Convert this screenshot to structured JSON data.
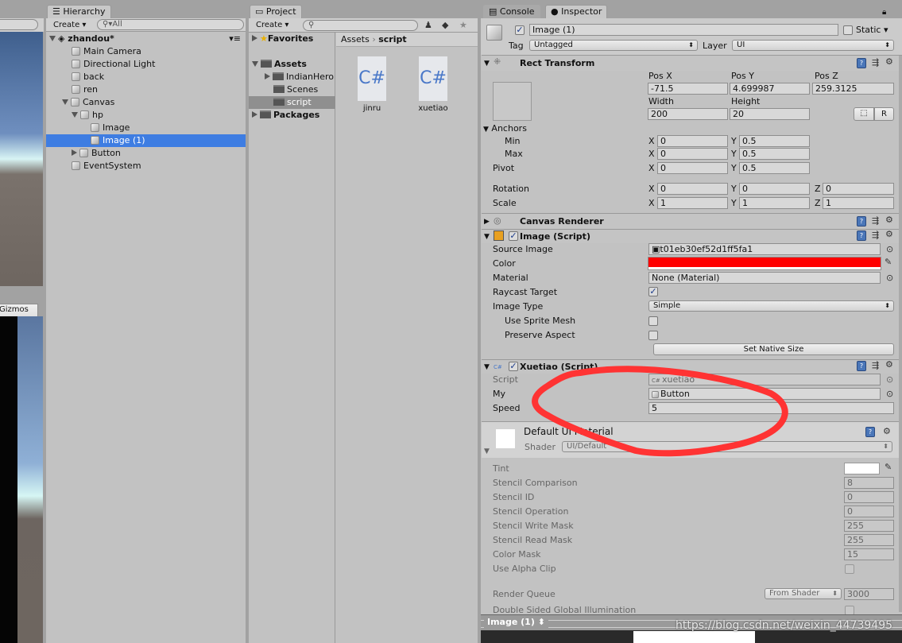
{
  "scene": {
    "gizmos_label": "Gizmos"
  },
  "hierarchy": {
    "tab": "Hierarchy",
    "create": "Create",
    "search_placeholder": "All",
    "scene_name": "zhandou*",
    "items": [
      "Main Camera",
      "Directional Light",
      "back",
      "ren",
      "Canvas",
      "hp",
      "Image",
      "Image (1)",
      "Button",
      "EventSystem"
    ],
    "selected": "Image (1)"
  },
  "project": {
    "tab": "Project",
    "create": "Create",
    "favorites": "Favorites",
    "assets": "Assets",
    "folders": [
      "IndianHero",
      "Scenes",
      "script"
    ],
    "packages": "Packages",
    "breadcrumb": [
      "Assets",
      "script"
    ],
    "files": [
      {
        "name": "jinru",
        "icon": "C#"
      },
      {
        "name": "xuetiao",
        "icon": "C#"
      }
    ]
  },
  "inspector": {
    "tabs": [
      "Console",
      "Inspector"
    ],
    "object_name": "Image (1)",
    "static_label": "Static",
    "tag_label": "Tag",
    "tag": "Untagged",
    "layer_label": "Layer",
    "layer": "UI",
    "rect": {
      "title": "Rect Transform",
      "pos_x_label": "Pos X",
      "pos_y_label": "Pos Y",
      "pos_z_label": "Pos Z",
      "pos_x": "-71.5",
      "pos_y": "4.699987",
      "pos_z": "259.3125",
      "width_label": "Width",
      "height_label": "Height",
      "width": "200",
      "height": "20",
      "r_button": "R",
      "anchors": "Anchors",
      "min": "Min",
      "max": "Max",
      "pivot": "Pivot",
      "rotation": "Rotation",
      "scale": "Scale",
      "x": "X",
      "y": "Y",
      "z": "Z",
      "min_x": "0",
      "min_y": "0.5",
      "max_x": "0",
      "max_y": "0.5",
      "pivot_x": "0",
      "pivot_y": "0.5",
      "rot_x": "0",
      "rot_y": "0",
      "rot_z": "0",
      "scale_x": "1",
      "scale_y": "1",
      "scale_z": "1"
    },
    "canvas_renderer": {
      "title": "Canvas Renderer"
    },
    "image": {
      "title": "Image (Script)",
      "source_label": "Source Image",
      "source": "t01eb30ef52d1ff5fa1",
      "color_label": "Color",
      "color": "#ff0000",
      "material_label": "Material",
      "material": "None (Material)",
      "raycast_label": "Raycast Target",
      "raycast": true,
      "type_label": "Image Type",
      "type": "Simple",
      "sprite_mesh_label": "Use Sprite Mesh",
      "preserve_label": "Preserve Aspect",
      "native_size": "Set Native Size"
    },
    "xuetiao": {
      "title": "Xuetiao (Script)",
      "script_label": "Script",
      "script": "xuetiao",
      "my_label": "My",
      "my": "Button",
      "speed_label": "Speed",
      "speed": "5"
    },
    "mat": {
      "title": "Default UI Material",
      "shader_label": "Shader",
      "shader": "UI/Default",
      "tint_label": "Tint",
      "props": [
        {
          "label": "Stencil Comparison",
          "value": "8"
        },
        {
          "label": "Stencil ID",
          "value": "0"
        },
        {
          "label": "Stencil Operation",
          "value": "0"
        },
        {
          "label": "Stencil Write Mask",
          "value": "255"
        },
        {
          "label": "Stencil Read Mask",
          "value": "255"
        },
        {
          "label": "Color Mask",
          "value": "15"
        }
      ],
      "alpha_clip_label": "Use Alpha Clip",
      "render_queue_label": "Render Queue",
      "render_queue_mode": "From Shader",
      "render_queue": "3000",
      "double_sided_label": "Double Sided Global Illumination"
    },
    "footer": "Image (1)"
  },
  "watermark": "https://blog.csdn.net/weixin_44739495",
  "annotation_color": "#ff3333"
}
